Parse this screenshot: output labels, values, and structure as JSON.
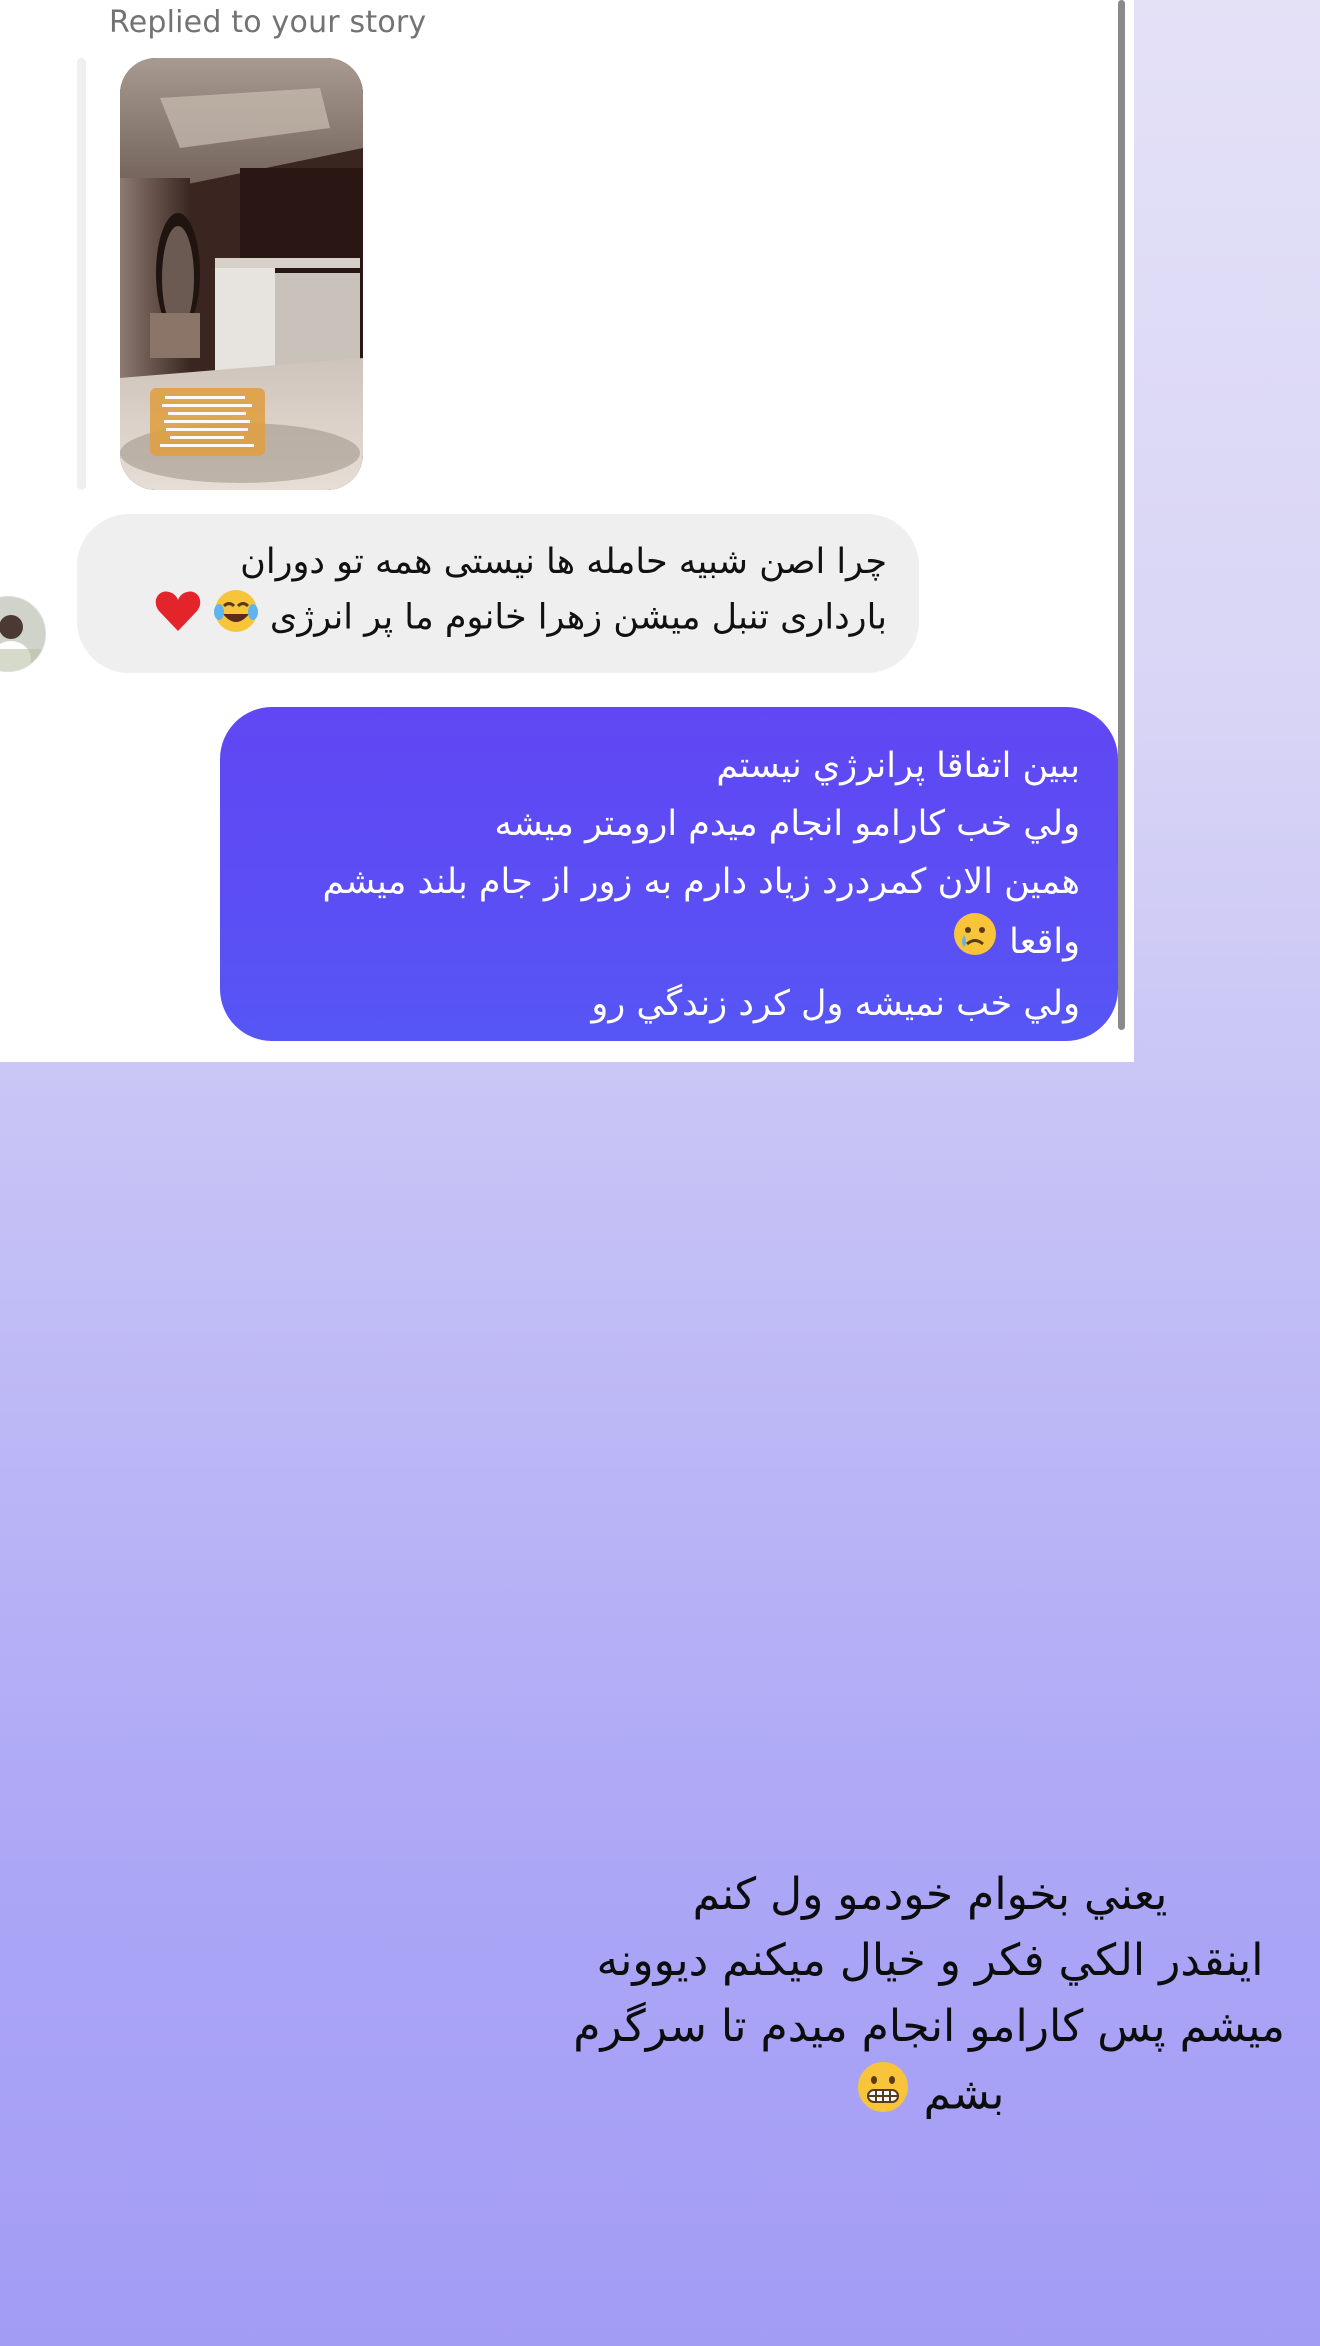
{
  "chat": {
    "reply_context": "Replied to your story",
    "incoming": {
      "lines": [
        "چرا اصن شبیه حامله ها نیستی همه تو دوران",
        "بارداری تنبل میشن زهرا خانوم ما پر انرژی"
      ],
      "emojis": [
        "laughing-tears-emoji",
        "red-heart-emoji"
      ]
    },
    "outgoing": {
      "lines": [
        "ببين اتفاقا پرانرژي نيستم",
        "ولي خب كارامو انجام ميدم ارومتر ميشه",
        "همين الان كمردرد زياد دارم به زور از جام بلند ميشم",
        "واقعا",
        "ولي خب نميشه ول كرد زندگي رو"
      ],
      "emojis": [
        "crying-face-emoji"
      ]
    }
  },
  "overlay": {
    "lines": [
      "يعني بخوام خودمو ول كنم",
      "اينقدر الكي فكر و خيال ميكنم ديوونه",
      "ميشم پس كارامو انجام ميدم تا سرگرم",
      "بشم"
    ],
    "emojis": [
      "grimacing-face-emoji"
    ]
  },
  "colors": {
    "outgoing_bubble": "#5b4ef4",
    "incoming_bubble": "#efefef",
    "background_top": "#e4e1f7",
    "background_bottom": "#a39cf5"
  }
}
